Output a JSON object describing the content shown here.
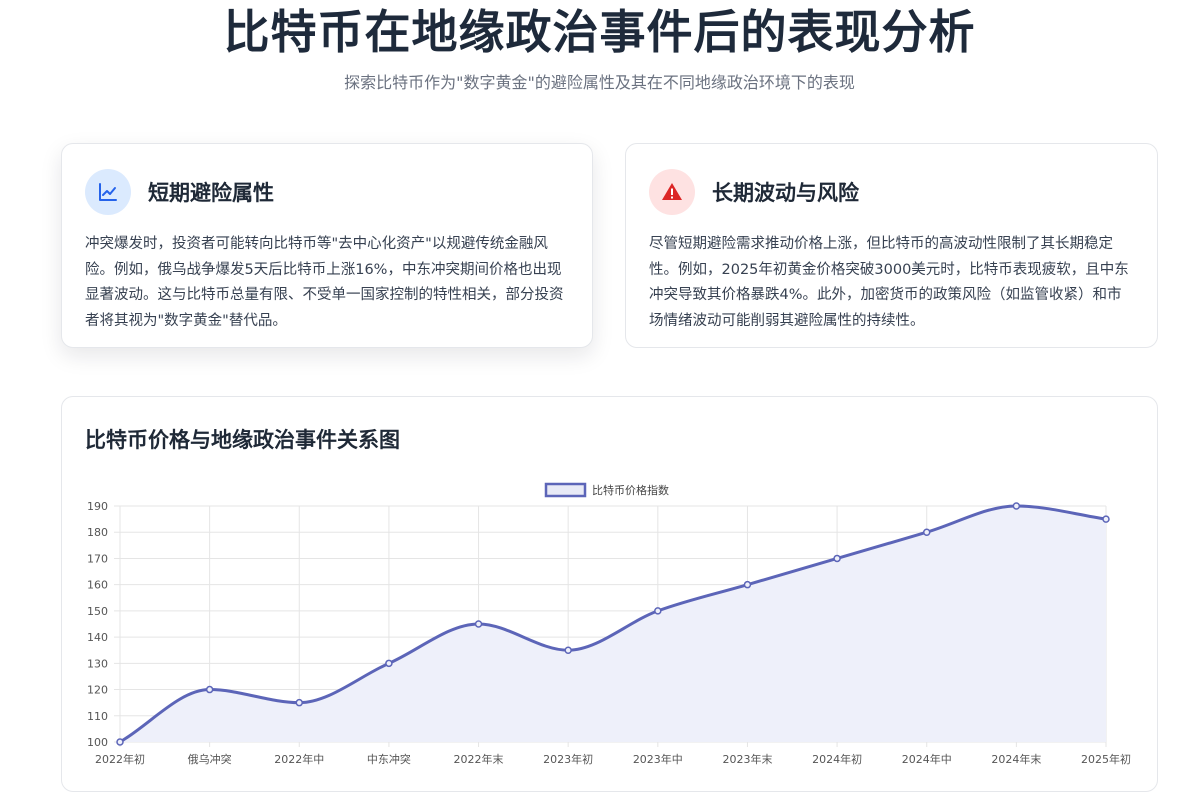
{
  "header": {
    "title": "比特币在地缘政治事件后的表现分析",
    "subtitle": "探索比特币作为\"数字黄金\"的避险属性及其在不同地缘政治环境下的表现"
  },
  "cards": {
    "short_term": {
      "icon": "trend-chart-icon",
      "title": "短期避险属性",
      "body": "冲突爆发时，投资者可能转向比特币等\"去中心化资产\"以规避传统金融风险。例如，俄乌战争爆发5天后比特币上涨16%，中东冲突期间价格也出现显著波动。这与比特币总量有限、不受单一国家控制的特性相关，部分投资者将其视为\"数字黄金\"替代品。"
    },
    "long_term": {
      "icon": "warning-triangle-icon",
      "title": "长期波动与风险",
      "body": "尽管短期避险需求推动价格上涨，但比特币的高波动性限制了其长期稳定性。例如，2025年初黄金价格突破3000美元时，比特币表现疲软，且中东冲突导致其价格暴跌4%。此外，加密货币的政策风险（如监管收紧）和市场情绪波动可能削弱其避险属性的持续性。"
    }
  },
  "colors": {
    "accent_blue": "#2563eb",
    "accent_red": "#dc2626",
    "series_line": "#5c65b8",
    "series_fill": "#eef0fa"
  },
  "chart_data": {
    "type": "line",
    "title": "比特币价格与地缘政治事件关系图",
    "categories": [
      "2022年初",
      "俄乌冲突",
      "2022年中",
      "中东冲突",
      "2022年末",
      "2023年初",
      "2023年中",
      "2023年末",
      "2024年初",
      "2024年中",
      "2024年末",
      "2025年初"
    ],
    "series": [
      {
        "name": "比特币价格指数",
        "values": [
          100,
          120,
          115,
          130,
          145,
          135,
          150,
          160,
          170,
          180,
          190,
          185
        ]
      }
    ],
    "ylim": [
      100,
      190
    ],
    "yticks": [
      100,
      110,
      120,
      130,
      140,
      150,
      160,
      170,
      180,
      190
    ],
    "legend": "top-center",
    "grid": true,
    "area_fill": true,
    "smooth": true
  }
}
